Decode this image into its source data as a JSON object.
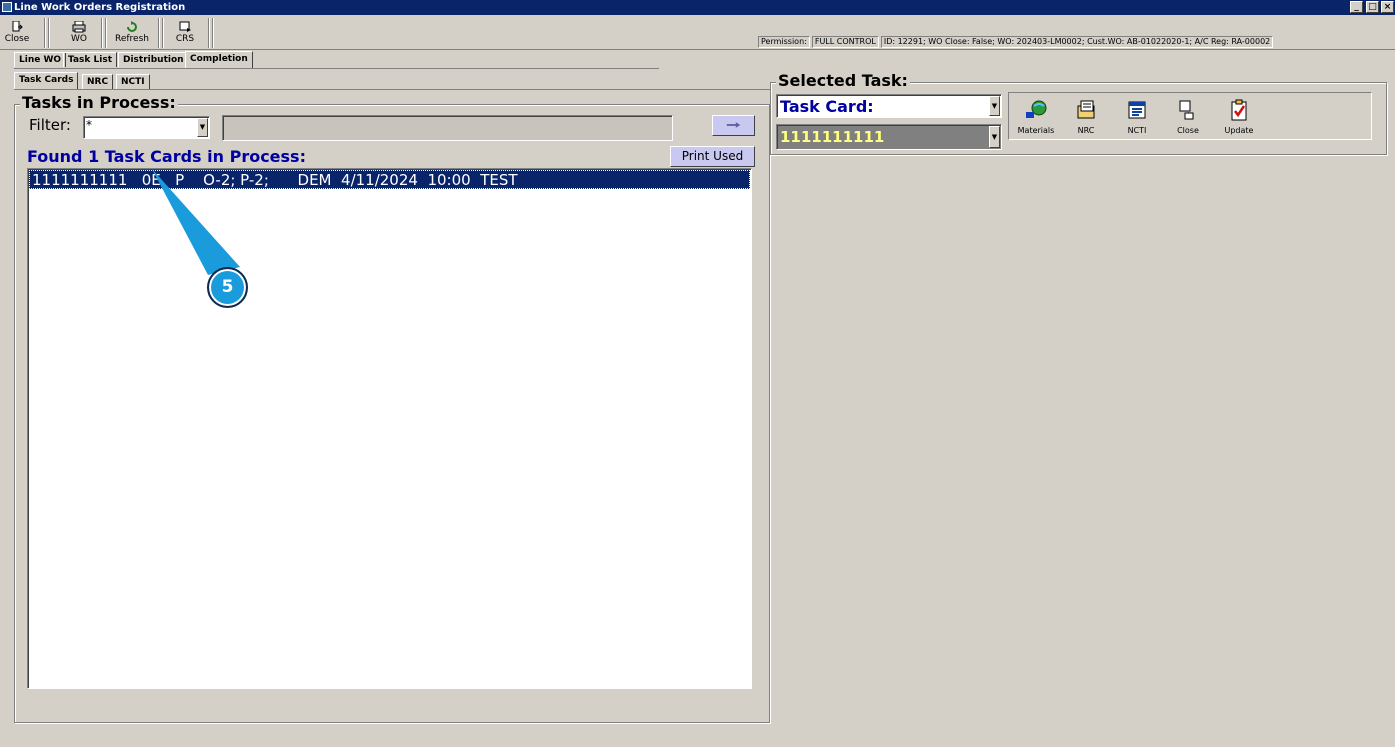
{
  "window": {
    "title": "Line Work Orders Registration",
    "controls": [
      "_",
      "□",
      "×"
    ]
  },
  "toolbar": {
    "close_label": "Close",
    "wo_label": "WO",
    "refresh_label": "Refresh",
    "crs_label": "CRS"
  },
  "status": {
    "permission_label": "Permission:",
    "permission_value": "FULL CONTROL",
    "info": "ID: 12291; WO Close: False; WO: 202403-LM0002; Cust.WO: AB-01022020-1; A/C Reg: RA-00002"
  },
  "main_tabs": [
    "Line WO",
    "Task List",
    "Distribution",
    "Completion"
  ],
  "sub_tabs": [
    "Task Cards",
    "NRC",
    "NCTI"
  ],
  "tasks_panel": {
    "title": "Tasks in Process:",
    "filter_label": "Filter:",
    "filter_value": "*",
    "go_icon": "arrow-right-icon",
    "found_text": "Found 1 Task Cards in Process:",
    "print_used_label": "Print Used",
    "rows": [
      "1111111111   0E   P    O-2; P-2;      DEM  4/11/2024  10:00  TEST"
    ]
  },
  "annotation": {
    "number": "5",
    "color": "#1a9bdc"
  },
  "selected_task": {
    "title": "Selected Task:",
    "type_value": "Task Card:",
    "card_value": "1111111111",
    "actions": [
      {
        "label": "Materials",
        "icon": "materials-icon"
      },
      {
        "label": "NRC",
        "icon": "nrc-icon"
      },
      {
        "label": "NCTI",
        "icon": "ncti-icon"
      },
      {
        "label": "Close",
        "icon": "close-doc-icon"
      },
      {
        "label": "Update",
        "icon": "update-check-icon"
      }
    ]
  },
  "colors": {
    "titlebar": "#0a246a",
    "accent_text": "#0000a0",
    "selection": "#0a246a",
    "card_value_text": "#ffff80",
    "card_value_bg": "#808080"
  }
}
